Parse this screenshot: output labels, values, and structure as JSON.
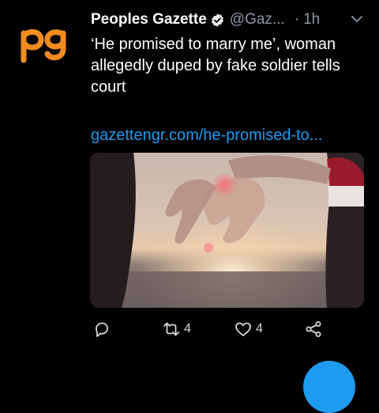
{
  "tweet": {
    "author_name": "Peoples Gazette",
    "handle": "@Gaz...",
    "separator": "·",
    "time": "1h",
    "text": "‘He promised to marry me’, woman allegedly duped by fake soldier tells court",
    "link": "gazettengr.com/he-promised-to...",
    "avatar_logo_text": "pg"
  },
  "actions": {
    "reply_count": "",
    "retweet_count": "4",
    "like_count": "4"
  },
  "colors": {
    "background": "#000000",
    "link": "#1d9bf0",
    "muted": "#8b98a5",
    "brand_orange": "#f28c1e"
  },
  "icons": [
    "verified-badge-icon",
    "chevron-down-icon",
    "reply-icon",
    "retweet-icon",
    "like-icon",
    "share-icon"
  ]
}
